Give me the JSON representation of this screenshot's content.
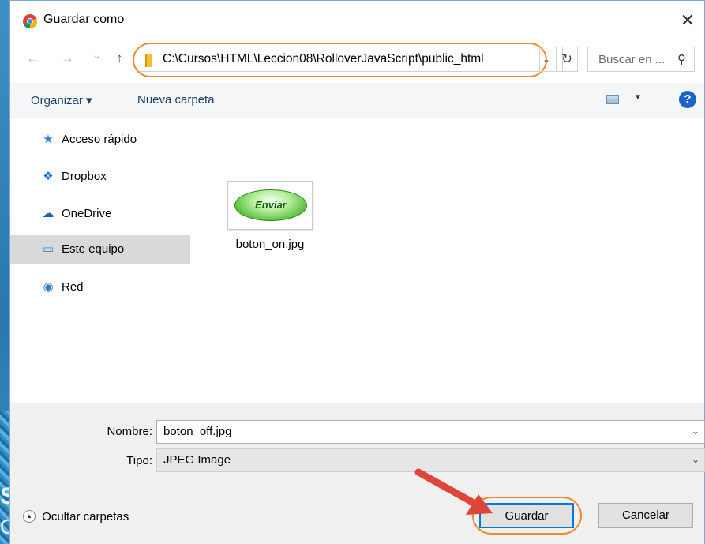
{
  "window": {
    "title": "Guardar como",
    "app_icon": "chrome-icon",
    "close_glyph": "✕"
  },
  "nav": {
    "back_glyph": "←",
    "forward_glyph": "→",
    "recent_glyph": "⌄",
    "up_glyph": "↑",
    "address": "C:\\Cursos\\HTML\\Leccion08\\RolloverJavaScript\\public_html",
    "address_dd_glyph": "⌄",
    "refresh_glyph": "↻",
    "search_placeholder": "Buscar en ...",
    "search_glyph": "⚲"
  },
  "toolbar": {
    "organize": "Organizar ▾",
    "new_folder": "Nueva carpeta",
    "view_dd": "▼",
    "help": "?"
  },
  "sidebar": {
    "items": [
      {
        "label": "Acceso rápido",
        "icon": "star-icon",
        "glyph": "★",
        "color": "#2b7fd6"
      },
      {
        "label": "Dropbox",
        "icon": "dropbox-icon",
        "glyph": "❖",
        "color": "#1f6fd0"
      },
      {
        "label": "OneDrive",
        "icon": "cloud-icon",
        "glyph": "☁",
        "color": "#1a5fb4"
      },
      {
        "label": "Este equipo",
        "icon": "computer-icon",
        "glyph": "▭",
        "color": "#2a8ad6"
      },
      {
        "label": "Red",
        "icon": "network-icon",
        "glyph": "◉",
        "color": "#2f7fc0"
      }
    ],
    "selected": "Este equipo"
  },
  "files": [
    {
      "name": "boton_on.jpg",
      "thumb_text": "Enviar"
    }
  ],
  "form": {
    "name_label": "Nombre:",
    "name_value": "boton_off.jpg",
    "type_label": "Tipo:",
    "type_value": "JPEG Image",
    "dd_glyph": "⌄",
    "hide_folders": "Ocultar carpetas",
    "hide_glyph": "▲",
    "save": "Guardar",
    "cancel": "Cancelar"
  },
  "background": {
    "glyph_s": "S",
    "glyph_c": "C"
  },
  "colors": {
    "highlight": "#ef8a2a",
    "arrow": "#e0453a",
    "accent": "#0078d7"
  }
}
